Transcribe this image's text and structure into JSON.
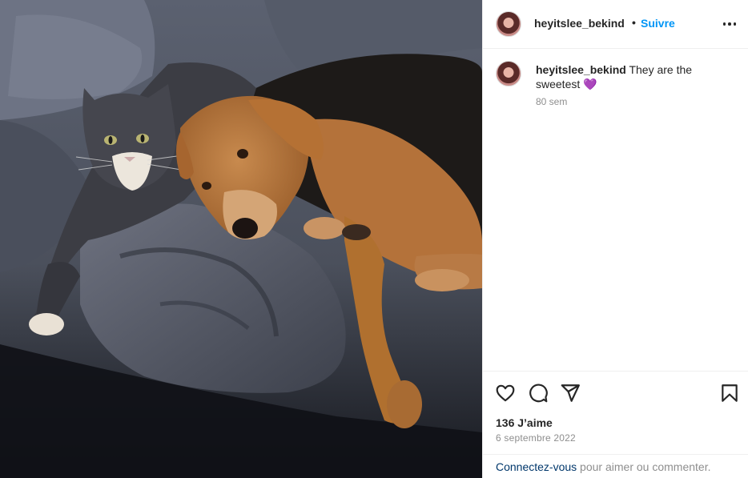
{
  "post": {
    "image_alt": "A grey and white cat and a tan and black hound dog lying together on grey bed sheets",
    "author": {
      "username": "heyitslee_bekind",
      "separator": "•",
      "follow_label": "Suivre"
    },
    "caption": {
      "username": "heyitslee_bekind",
      "text": " They are the sweetest ",
      "emoji": "💜",
      "time_ago": "80 sem"
    },
    "likes_text": "136 J’aime",
    "date_text": "6 septembre 2022",
    "footer": {
      "login_link": "Connectez-vous",
      "login_rest": " pour aimer ou commenter."
    }
  },
  "icons": {
    "like": "heart-outline-icon",
    "comment": "comment-bubble-icon",
    "share": "paper-plane-icon",
    "save": "bookmark-icon",
    "more": "more-dots-icon"
  },
  "colors": {
    "accent": "#0095f6",
    "link": "#00376b",
    "muted": "#8e8e8e",
    "emoji": "#a855f7"
  }
}
